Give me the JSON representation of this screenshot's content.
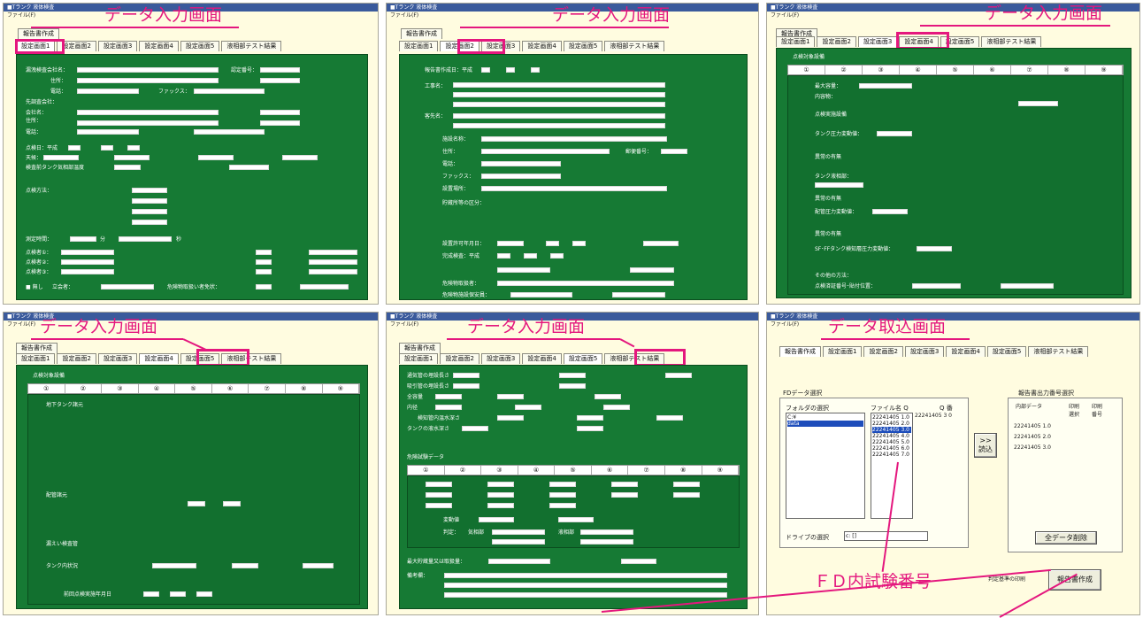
{
  "window_title": "■Tランク 液体検査",
  "menu_file": "ファイル(F)",
  "report_tab": "報告書作成",
  "captions": {
    "p1": "データ入力画面",
    "p2": "データ入力画面",
    "p3": "データ入力画面",
    "p4": "データ入力画面",
    "p5": "データ入力画面",
    "p6": "データ取込画面",
    "fd_number": "ＦＤ内試験番号"
  },
  "tabs": [
    "設定画面1",
    "設定画面2",
    "設定画面3",
    "設定画面4",
    "設定画面5",
    "液相部テスト結果"
  ],
  "p1_labels": [
    "漏洩検査会社名：",
    "住所：",
    "電話：",
    "先調査会社：",
    "会社名：",
    "住所：",
    "電話：",
    "点検日：平成",
    "天候：",
    "検査前タンク気相部温度",
    "点検方法：",
    "測定時間：",
    "点検者①：",
    "点検者②：",
    "点検者③：",
    "■ 無し",
    "立会者：",
    "危険物取扱い者免状：",
    "認定番号：",
    "ファックス：",
    "分",
    "秒"
  ],
  "p2_labels": [
    "報告書作成日：平成",
    "工事名：",
    "客先名：",
    "施設名称：",
    "住所：",
    "電話：",
    "ファックス：",
    "設置場所：",
    "貯蔵所等の区分：",
    "設置許可年月日：",
    "完成検査：平成",
    "危険物取扱者：",
    "危険物施設保安員：",
    "郵便番号："
  ],
  "p3_labels": [
    "点検対象設備",
    "最大容量：",
    "内容物：",
    "点検実施設備",
    "タンク圧力変動値：",
    "異常の有無",
    "タンク液相部：",
    "配管圧力変動値：",
    "SF･FFタンク検知層圧力変動値：",
    "その他の方法：",
    "点検済証番号･貼付位置："
  ],
  "p4_labels": [
    "点検対象設備",
    "地下タンク諸元",
    "配管諸元",
    "漏えい検査管",
    "タンク内状況",
    "前回点検実施年月日"
  ],
  "p5_labels": [
    "通気管の埋設長さ",
    "吸引管の埋設長さ",
    "全容量",
    "内径",
    "検知管内温水深さ",
    "タンクの液水深さ",
    "危険試験データ",
    "最大貯蔵量又は取扱量：",
    "備考欄：",
    "変動値",
    "判定：",
    "気相部",
    "液相部"
  ],
  "p5_inner_tabs": [
    "①",
    "②",
    "③",
    "④",
    "⑤",
    "⑥",
    "⑦",
    "⑧",
    "⑨"
  ],
  "p6": {
    "fd_section": "FDデータ選択",
    "folder_label": "フォルダの選択",
    "file_label": "ファイル名 Q",
    "q_label": "Q 番",
    "folders": [
      "C:¥",
      "data"
    ],
    "files": [
      "22241405 1.0",
      "22241405 2.0",
      "22241405 3.0",
      "22241405 4.0",
      "22241405 5.0",
      "22241405 6.0",
      "22241405 7.0"
    ],
    "selected_numbers": [
      "22241405 3 0"
    ],
    "drive_label": "ドライブの選択",
    "drive_value": "c: []",
    "load_button": "読込",
    "load_arrow": ">>",
    "output_section": "報告書出力番号選択",
    "col_internal": "内部データ",
    "col_print_select": "印刷選択",
    "col_print_no": "印刷番号",
    "output_rows": [
      "22241405 1.0",
      "22241405 2.0",
      "22241405 3.0"
    ],
    "clear_button": "全データ削除",
    "print_label": "判定基準の印刷",
    "report_button": "報告書作成"
  }
}
